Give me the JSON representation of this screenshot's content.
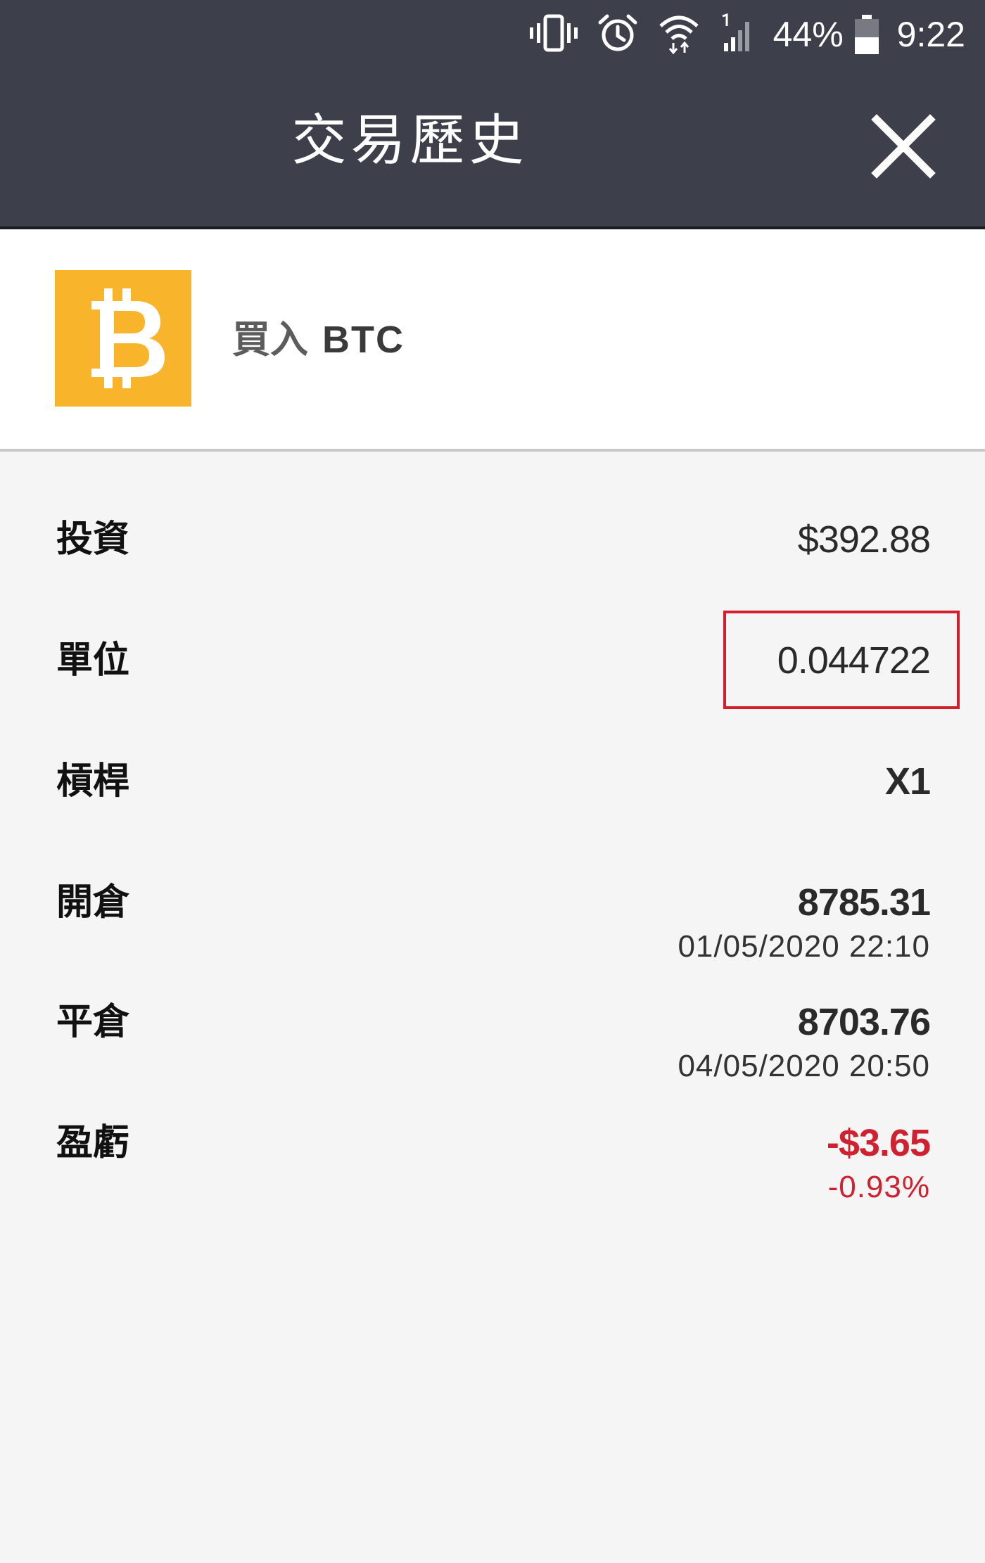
{
  "status_bar": {
    "battery_percent": "44%",
    "time": "9:22",
    "icons": [
      "vibrate-icon",
      "alarm-icon",
      "wifi-icon",
      "cell-signal-icon",
      "battery-icon"
    ]
  },
  "header": {
    "title": "交易歷史",
    "close_icon": "close-icon"
  },
  "asset": {
    "icon": "bitcoin-icon",
    "action": "買入",
    "ticker": "BTC",
    "brand_color": "#f8b52c"
  },
  "details": {
    "investment": {
      "label": "投資",
      "value": "$392.88"
    },
    "units": {
      "label": "單位",
      "value": "0.044722"
    },
    "leverage": {
      "label": "槓桿",
      "value": "X1"
    },
    "open": {
      "label": "開倉",
      "price": "8785.31",
      "datetime": "01/05/2020 22:10"
    },
    "close": {
      "label": "平倉",
      "price": "8703.76",
      "datetime": "04/05/2020 20:50"
    },
    "pnl": {
      "label": "盈虧",
      "amount": "-$3.65",
      "percent": "-0.93%"
    }
  },
  "colors": {
    "header_bg": "#3d3f4a",
    "negative": "#cf2230",
    "highlight": "#d21f2b"
  }
}
